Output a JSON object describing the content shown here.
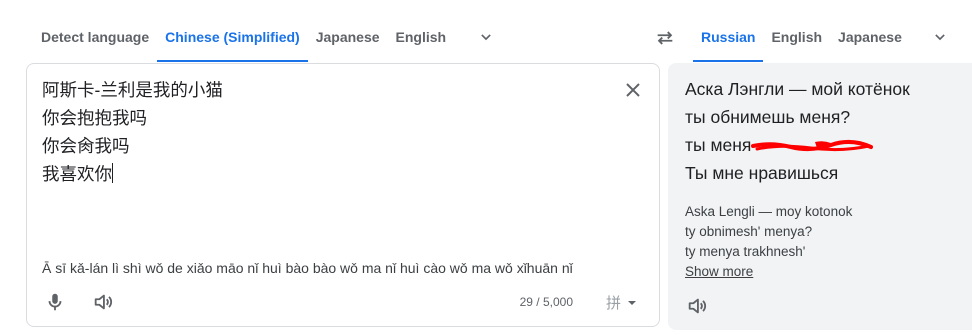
{
  "source_langs": {
    "tabs": [
      "Detect language",
      "Chinese (Simplified)",
      "Japanese",
      "English"
    ],
    "active_index": 1
  },
  "target_langs": {
    "tabs": [
      "Russian",
      "English",
      "Japanese"
    ],
    "active_index": 0
  },
  "source": {
    "lines": [
      "阿斯卡-兰利是我的小猫",
      "你会抱抱我吗",
      "你会肏我吗",
      "我喜欢你"
    ],
    "transliteration": "Ā sī kǎ-lán lì shì wǒ de xiǎo māo nǐ huì bào bào wǒ ma nǐ huì cào wǒ ma wǒ xǐhuān nǐ",
    "char_count": "29 / 5,000",
    "ime_glyph": "拼"
  },
  "target": {
    "lines": [
      "Аска Лэнгли — мой котёнок",
      "ты обнимешь меня?",
      "ты меня",
      "Ты мне нравишься"
    ],
    "redaction_color": "#ff0000",
    "transliteration_lines": [
      "Aska Lengli — moy kotonok",
      "ty obnimesh' menya?",
      "ty menya trakhnesh'"
    ],
    "show_more": "Show more"
  },
  "icons": {
    "chevron": "chevron-down-icon",
    "swap": "swap-arrows-icon",
    "clear": "close-icon",
    "mic": "microphone-icon",
    "speaker": "speaker-icon"
  },
  "colors": {
    "accent": "#1a73e8",
    "text": "#202124",
    "muted": "#5f6368",
    "target_bg": "#f1f3f4"
  }
}
